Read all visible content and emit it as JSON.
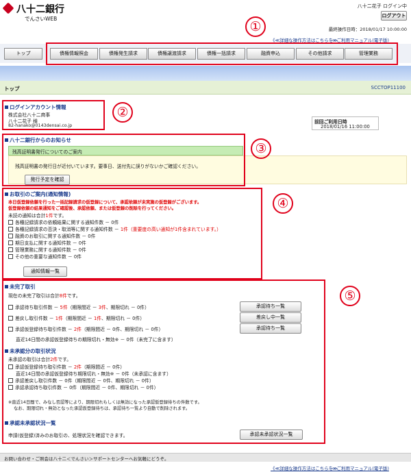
{
  "header": {
    "brand": "八十二銀行",
    "sub": "でんさいWEB",
    "user": "八十二花子 ログイン中",
    "logout": "ログアウト",
    "last_op": "最終操作日時：2018/01/17 10:00:00",
    "help_link": "《≪詳細な操作方法はこちらを≫",
    "manual": "⇒ ご利用マニュアル(電子版)"
  },
  "nav": {
    "top": "トップ",
    "items": [
      "債権情報照会",
      "債権発生請求",
      "債権譲渡請求",
      "債権一括請求",
      "融資申込",
      "その他請求",
      "管理業務"
    ]
  },
  "page": {
    "title": "トップ",
    "code": "SCCTOP11100"
  },
  "account": {
    "heading": "ログインアカウント情報",
    "company": "株式会社八十二商事",
    "name": "八十二花子 様",
    "email": "82-hanako@0143densai.co.jp",
    "prev_label": "前回ご利用日時",
    "prev_value": "2018/01/16 11:00:00"
  },
  "notice": {
    "heading": "八十二銀行からのお知らせ",
    "title": "残高証明書発行についてのご案内",
    "body": "残高証明書の発行日が近付いています。要事日、送付先に誤りがないかご確認ください。",
    "button": "発行予定を確認"
  },
  "guide": {
    "heading": "お取引のご案内(通知情報)",
    "warn1": "本日仮登録依頼を行った一括記録請求の仮登録について、承認依頼が未実施の仮登録がございます。",
    "warn2": "仮登録依頼の結果通知をご確認後、承認依頼、または仮登録の削除を行ってください。",
    "unread_pre": "未読の通知は合計",
    "unread_n": "1件",
    "unread_post": "です。",
    "items": [
      {
        "text": "各種記録請求の依頼結果に関する通知件数 － ",
        "count": "0件",
        "extra": ""
      },
      {
        "text": "各種記録請求の否決・取消等に関する通知件数 － ",
        "count": "1件",
        "extra": "（重要度の高い通知が1件含まれています。）"
      },
      {
        "text": "融資のお取引に関する通知件数 － ",
        "count": "0件",
        "extra": ""
      },
      {
        "text": "期日支払に関する通知件数 － ",
        "count": "0件",
        "extra": ""
      },
      {
        "text": "管理業務に関する通知件数 － ",
        "count": "0件",
        "extra": ""
      },
      {
        "text": "その他の重要な通知件数 － ",
        "count": "0件",
        "extra": ""
      }
    ],
    "button": "通知情報一覧"
  },
  "pending": {
    "heading": "未完了取引",
    "total_pre": "現在の未完了取引は合計",
    "total_n": "8件",
    "total_post": "です。",
    "rows": [
      {
        "text": "承認待ち取引件数 － ",
        "count": "5件",
        "mid": "（期限間近 － ",
        "mid_n": "3件",
        "tail": "、期限切れ － 0件）",
        "button": "承認待ち一覧"
      },
      {
        "text": "差戻し取引件数 － ",
        "count": "1件",
        "mid": "（期限間近 － ",
        "mid_n": "1件",
        "tail": "、期限切れ － 0件）",
        "button": "差戻し中一覧"
      },
      {
        "text": "承認仮登録待ち取引件数 － ",
        "count": "2件",
        "mid": "（期限間近 － ",
        "mid_n": "0件",
        "tail": "、期限切れ － 0件）",
        "button": "承認待ち一覧"
      }
    ],
    "recent": "直近14日間の承認仮登録待ちの期限切れ・無効※ － 0件（未完了に含ます）"
  },
  "unapproved": {
    "heading": "未承認分の取引状況",
    "total_pre": "未承認の取引は合計",
    "total_n": "2件",
    "total_post": "です。",
    "rows": [
      {
        "text": "承認仮登録待ち取引件数 － ",
        "count": "2件",
        "tail": "（期限間近 － 0件）"
      },
      {
        "text": "直近14日間の承認仮登録待ち期限切れ・無効※ － 0件（未承認に含ます）",
        "count": "",
        "tail": ""
      },
      {
        "text": "承認差戻し取引件数 － 0件（期限間近 － 0件、期限切れ － 0件）",
        "count": "",
        "tail": ""
      },
      {
        "text": "承認承認待ち取引件数 － 0件（期限間近 － 0件、期限切れ － 0件）",
        "count": "",
        "tail": ""
      }
    ],
    "note1": "※直近14日間で、みなし否認等により、期限切れもしくは無効になった承認仮登録待ちの件数です。",
    "note2": "なお、期限切れ・無効となった承認仮登録待ちは、承認待ち一覧より自動で削除されます。"
  },
  "status": {
    "heading": "承認未承認状況一覧",
    "text": "申請(仮登録)済みのお取引の、処理状況を確認できます。",
    "button": "承認未承認状況一覧"
  },
  "footer": {
    "contact": "お問い合わせ・ご照会は八十二＜でんさい＞サポートセンターへお気軽にどうぞ。",
    "help_link": "《≪詳細な操作方法はこちらを≫",
    "manual": "⇒ ご利用マニュアル(電子版)"
  },
  "markers": [
    "①",
    "②",
    "③",
    "④",
    "⑤"
  ],
  "colors": {
    "brand": "#c8001e",
    "accent": "#1a3b8c",
    "highlight_red": "#e0001a",
    "notice_bg": "#fffce0"
  }
}
